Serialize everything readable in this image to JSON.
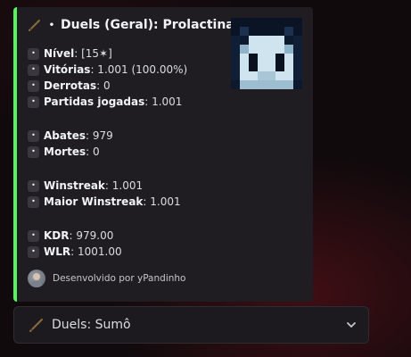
{
  "embed": {
    "accent_color": "#57f25c",
    "title_prefix": "•",
    "title": "Duels (Geral): Prolactina",
    "stats": [
      {
        "label": "Nível",
        "value": ": [15✶]"
      },
      {
        "label": "Vitórias",
        "value": ": 1.001 (100.00%)"
      },
      {
        "label": "Derrotas",
        "value": ": 0"
      },
      {
        "label": "Partidas jogadas",
        "value": ": 1.001"
      },
      {
        "label": "Abates",
        "value": ": 979"
      },
      {
        "label": "Mortes",
        "value": ": 0"
      },
      {
        "label": "Winstreak",
        "value": ": 1.001"
      },
      {
        "label": "Maior Winstreak",
        "value": ": 1.001"
      },
      {
        "label": "KDR",
        "value": ": 979.00"
      },
      {
        "label": "WLR",
        "value": ": 1001.00"
      }
    ],
    "bullet_glyph": "•",
    "thumbnail_icon": "pixel-skin-head-icon",
    "footer_text": "Desenvolvido por yPandinho"
  },
  "select": {
    "icon": "wooden-sword-icon",
    "value": "Duels: Sumô",
    "chevron": "chevron-down-icon"
  }
}
